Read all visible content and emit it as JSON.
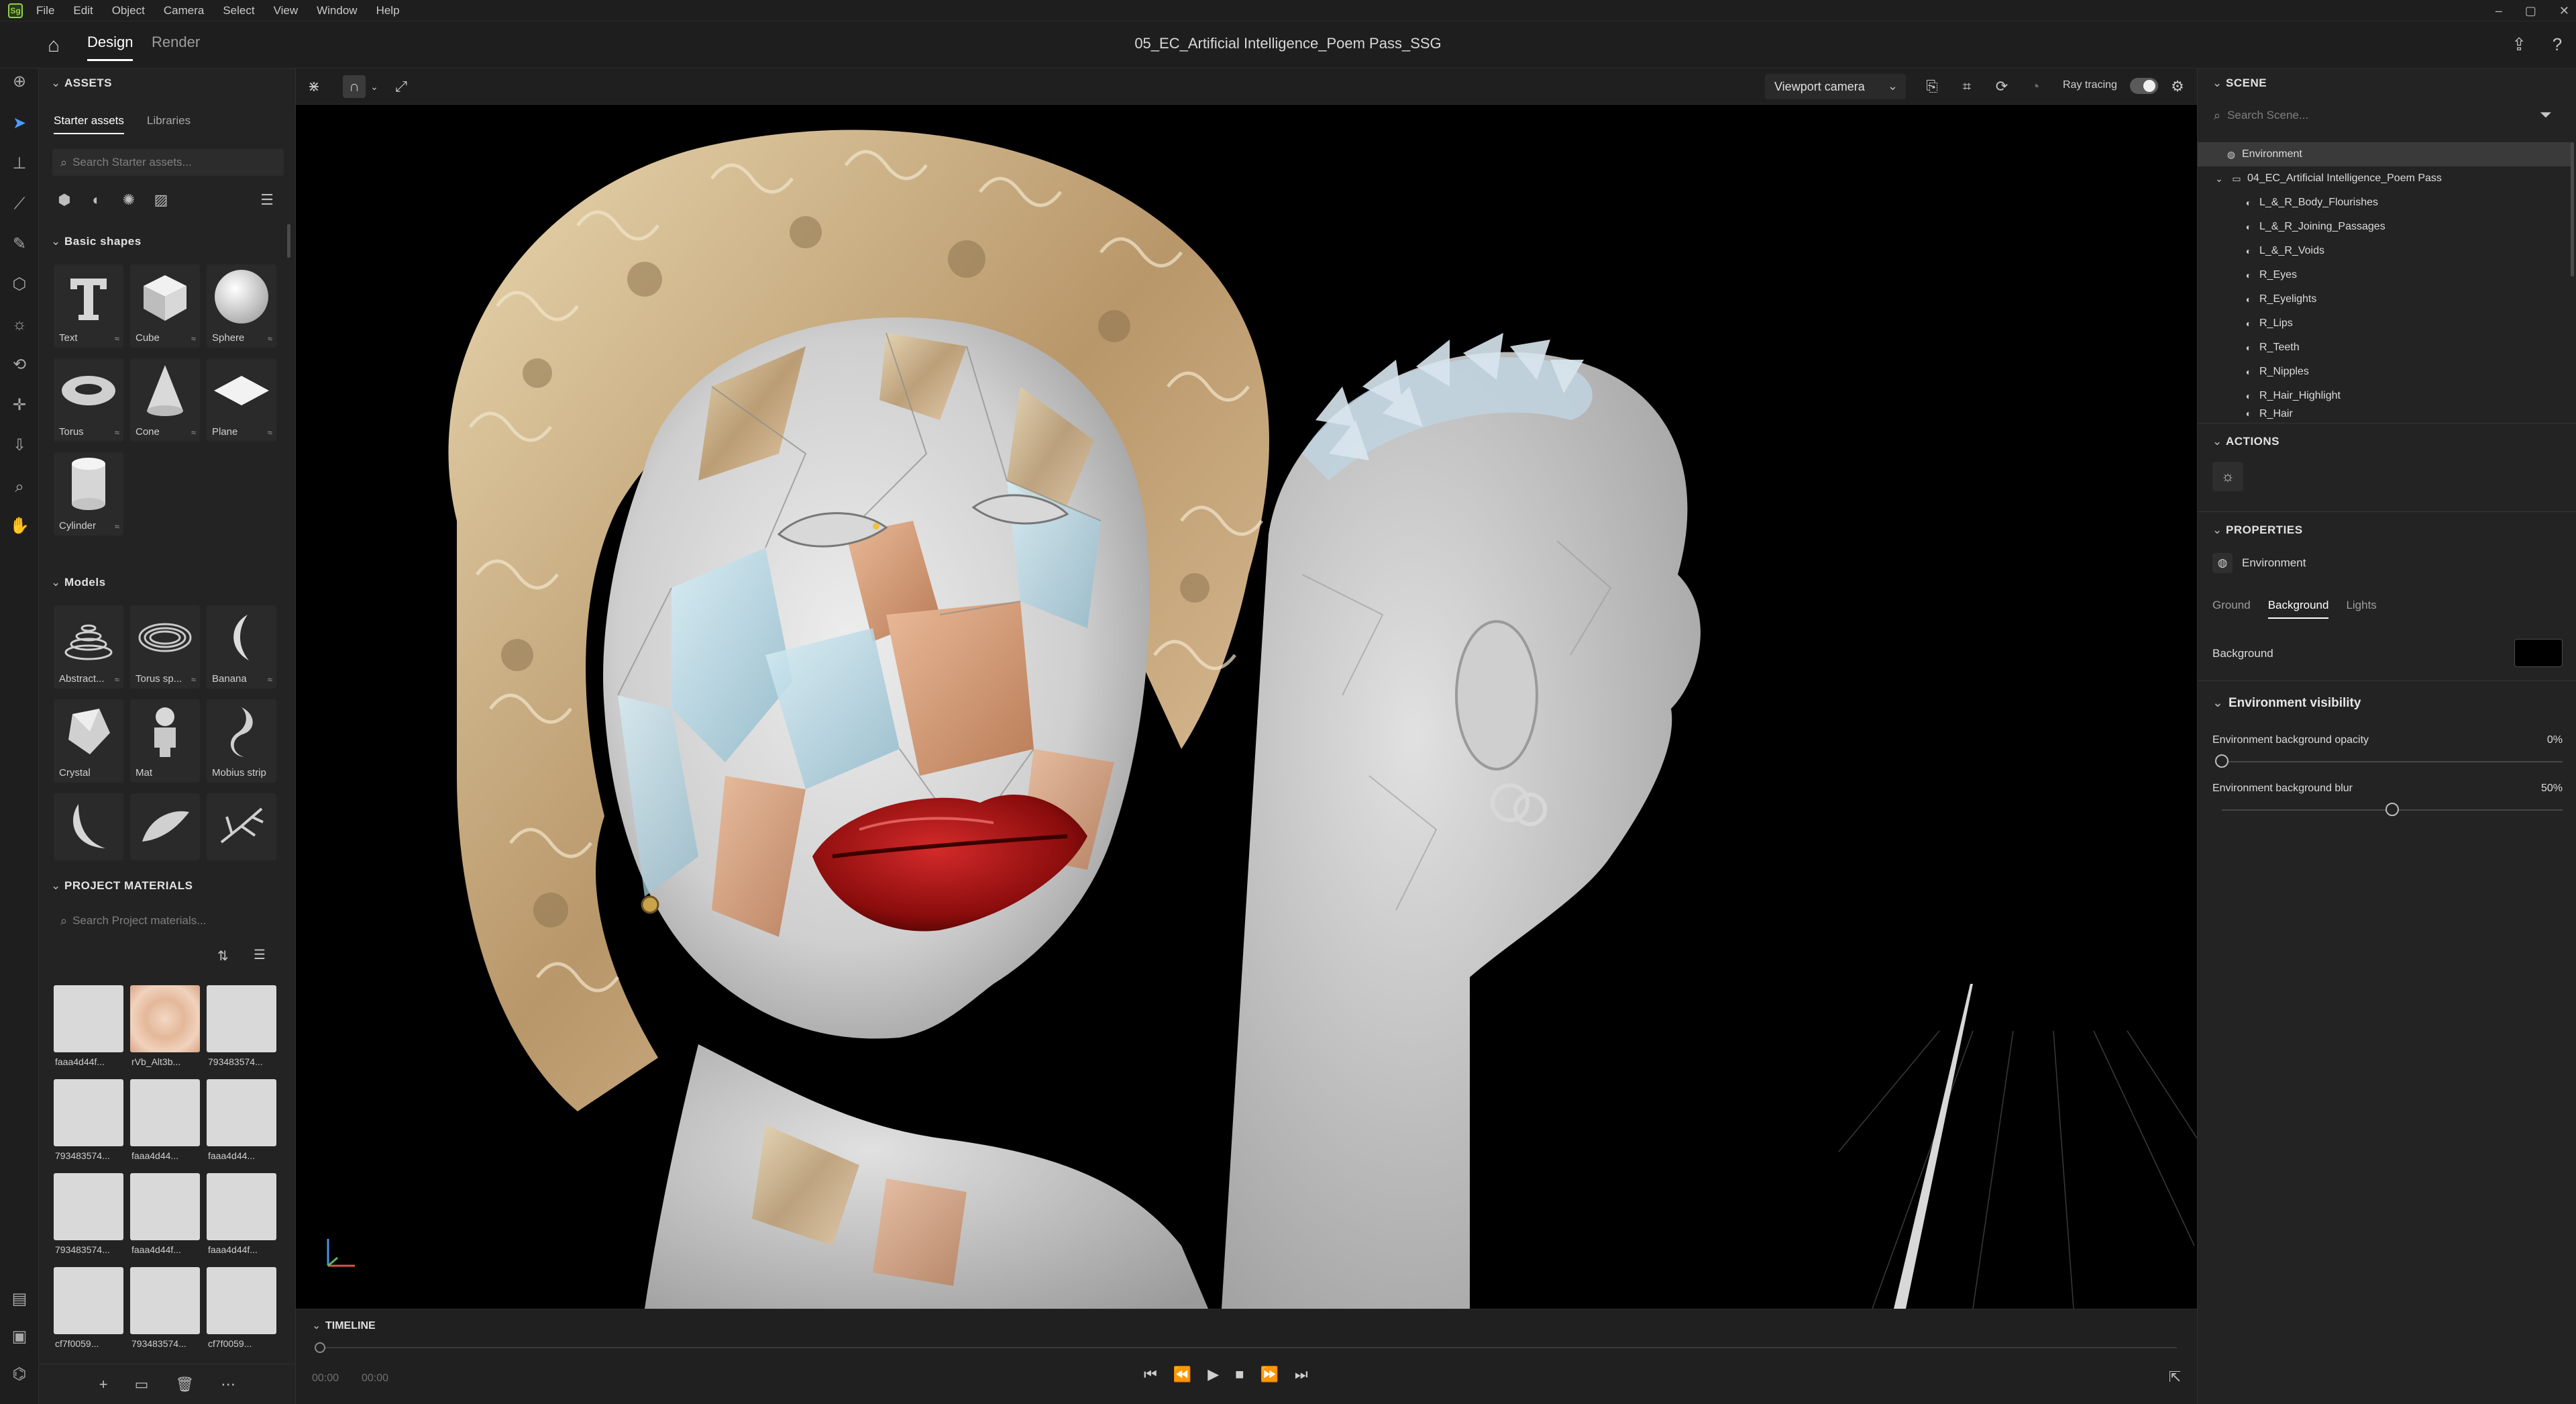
{
  "menu": [
    "File",
    "Edit",
    "Object",
    "Camera",
    "Select",
    "View",
    "Window",
    "Help"
  ],
  "header": {
    "tabs": [
      "Design",
      "Render"
    ],
    "document_title": "05_EC_Artificial Intelligence_Poem Pass_SSG"
  },
  "assets": {
    "title": "ASSETS",
    "subtabs": [
      "Starter assets",
      "Libraries"
    ],
    "search_placeholder": "Search Starter assets...",
    "basic_shapes_title": "Basic shapes",
    "basic_shapes": [
      "Text",
      "Cube",
      "Sphere",
      "Torus",
      "Cone",
      "Plane",
      "Cylinder"
    ],
    "models_title": "Models",
    "models": [
      "Abstract...",
      "Torus sp...",
      "Banana",
      "Crystal",
      "Mat",
      "Mobius strip"
    ],
    "project_materials_title": "PROJECT MATERIALS",
    "materials_search_placeholder": "Search Project materials...",
    "materials": [
      "faaa4d44f...",
      "rVb_Alt3b...",
      "793483574...",
      "793483574...",
      "faaa4d44...",
      "faaa4d44...",
      "793483574...",
      "faaa4d44f...",
      "faaa4d44f...",
      "cf7f0059...",
      "793483574...",
      "cf7f0059..."
    ]
  },
  "viewport": {
    "camera": "Viewport camera",
    "ray_tracing_label": "Ray tracing",
    "ray_tracing_on": false
  },
  "timeline": {
    "title": "TIMELINE",
    "time_start": "00:00",
    "time_end": "00:00"
  },
  "scene": {
    "title": "SCENE",
    "search_placeholder": "Search Scene...",
    "items": [
      {
        "label": "Environment",
        "level": 0
      },
      {
        "label": "04_EC_Artificial Intelligence_Poem Pass",
        "level": 0
      },
      {
        "label": "L_&_R_Body_Flourishes",
        "level": 1
      },
      {
        "label": "L_&_R_Joining_Passages",
        "level": 1
      },
      {
        "label": "L_&_R_Voids",
        "level": 1
      },
      {
        "label": "R_Eyes",
        "level": 1
      },
      {
        "label": "R_Eyelights",
        "level": 1
      },
      {
        "label": "R_Lips",
        "level": 1
      },
      {
        "label": "R_Teeth",
        "level": 1
      },
      {
        "label": "R_Nipples",
        "level": 1
      },
      {
        "label": "R_Hair_Highlight",
        "level": 1
      },
      {
        "label": "R_Hair",
        "level": 1
      }
    ]
  },
  "actions": {
    "title": "ACTIONS"
  },
  "properties": {
    "title": "PROPERTIES",
    "object": "Environment",
    "tabs": [
      "Ground",
      "Background",
      "Lights"
    ],
    "background_label": "Background",
    "background_color": "#000000",
    "env_visibility_title": "Environment visibility",
    "opacity_label": "Environment background opacity",
    "opacity_value": "0%",
    "opacity_fraction": 0.0,
    "blur_label": "Environment background blur",
    "blur_value": "50%",
    "blur_fraction": 0.5
  }
}
